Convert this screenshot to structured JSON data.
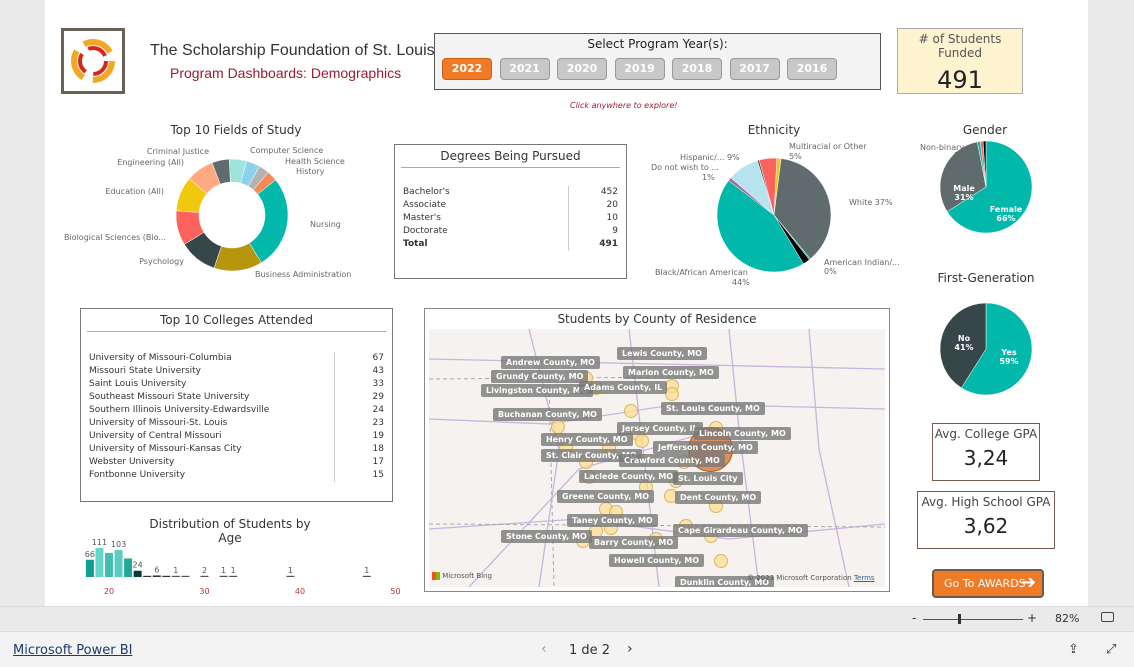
{
  "header": {
    "org": "The Scholarship Foundation of St. Louis",
    "subtitle": "Program Dashboards: Demographics",
    "logo_colors": [
      "#f5a623",
      "#d9261c"
    ]
  },
  "year_selector": {
    "label": "Select Program Year(s):",
    "years": [
      "2022",
      "2021",
      "2020",
      "2019",
      "2018",
      "2017",
      "2016"
    ],
    "selected": "2022",
    "hint": "Click anywhere to explore!"
  },
  "kpi_funded": {
    "label": "# of Students Funded",
    "value": "491"
  },
  "fields_of_study": {
    "title": "Top 10 Fields of Study",
    "slices": [
      {
        "name": "Computer Science",
        "value": 5,
        "color": "#9ee3dc"
      },
      {
        "name": "Health Science",
        "value": 4,
        "color": "#8ad3ea"
      },
      {
        "name": "History",
        "value": 3,
        "color": "#b3b3b3"
      },
      {
        "name": "",
        "value": 3,
        "color": "#f68a55"
      },
      {
        "name": "Nursing",
        "value": 27,
        "color": "#01b8aa"
      },
      {
        "name": "Business Administration",
        "value": 14,
        "color": "#b8960c"
      },
      {
        "name": "Psychology",
        "value": 11,
        "color": "#374649"
      },
      {
        "name": "Biological Sciences (Bio...",
        "value": 10,
        "color": "#fd625e"
      },
      {
        "name": "Education (All)",
        "value": 10,
        "color": "#f2c80f"
      },
      {
        "name": "Engineering (All)",
        "value": 8,
        "color": "#fea981"
      },
      {
        "name": "Criminal Justice",
        "value": 5,
        "color": "#5f6b6d"
      }
    ]
  },
  "degrees": {
    "title": "Degrees Being Pursued",
    "rows": [
      {
        "name": "Bachelor's",
        "count": "452"
      },
      {
        "name": "Associate",
        "count": "20"
      },
      {
        "name": "Master's",
        "count": "10"
      },
      {
        "name": "Doctorate",
        "count": "9"
      }
    ],
    "total": {
      "name": "Total",
      "count": "491"
    }
  },
  "ethnicity": {
    "title": "Ethnicity",
    "slices": [
      {
        "name": "",
        "value": 1.2,
        "color": "#f2c80f"
      },
      {
        "name": "White 37%",
        "value": 37,
        "color": "#5f6b6d"
      },
      {
        "name": "",
        "value": 0.4,
        "color": "#01b8aa"
      },
      {
        "name": "",
        "value": 2,
        "color": "#000000"
      },
      {
        "name": "Black/African American 44%",
        "value": 44,
        "color": "#01b8aa"
      },
      {
        "name": "Do not wish to ... 1%",
        "value": 1,
        "color": "#a66999"
      },
      {
        "name": "Hispanic/... 9%",
        "value": 9,
        "color": "#b7e3ee"
      },
      {
        "name": "",
        "value": 0.5,
        "color": "#374649"
      },
      {
        "name": "Multiracial or Other 5%",
        "value": 5,
        "color": "#fd625e"
      }
    ],
    "labels": {
      "white": "White 37%",
      "black": "Black/African American",
      "black_pct": "44%",
      "american_indian": "American Indian/...",
      "american_indian_pct": "0%",
      "hispanic": "Hispanic/... 9%",
      "dnw": "Do not wish to ...",
      "dnw_pct": "1%",
      "multi": "Multiracial or Other",
      "multi_pct": "5%"
    }
  },
  "gender": {
    "title": "Gender",
    "slices": [
      {
        "name": "Female",
        "pct": "66%",
        "value": 66,
        "color": "#01b8aa"
      },
      {
        "name": "Male",
        "pct": "31%",
        "value": 31,
        "color": "#5f6b6d"
      },
      {
        "name": "Non-binary",
        "pct": "1%",
        "value": 1,
        "color": "#01b8aa"
      },
      {
        "name": "",
        "value": 1,
        "color": "#fd625e"
      },
      {
        "name": "",
        "value": 1,
        "color": "#000000"
      }
    ]
  },
  "first_gen": {
    "title": "First-Generation",
    "slices": [
      {
        "name": "Yes",
        "pct": "59%",
        "value": 59,
        "color": "#01b8aa"
      },
      {
        "name": "No",
        "pct": "41%",
        "value": 41,
        "color": "#374649"
      }
    ]
  },
  "colleges": {
    "title": "Top 10 Colleges Attended",
    "rows": [
      {
        "name": "University of Missouri-Columbia",
        "count": "67"
      },
      {
        "name": "Missouri State University",
        "count": "43"
      },
      {
        "name": "Saint Louis University",
        "count": "33"
      },
      {
        "name": "Southeast Missouri State University",
        "count": "29"
      },
      {
        "name": "Southern Illinois University-Edwardsville",
        "count": "24"
      },
      {
        "name": "University of Missouri-St. Louis",
        "count": "23"
      },
      {
        "name": "University of Central Missouri",
        "count": "19"
      },
      {
        "name": "University of Missouri-Kansas City",
        "count": "18"
      },
      {
        "name": "Webster University",
        "count": "17"
      },
      {
        "name": "Fontbonne University",
        "count": "15"
      }
    ]
  },
  "chart_data": {
    "type": "bar",
    "title": "Distribution of Students by Age",
    "x_ticks": [
      "20",
      "30",
      "40",
      "50"
    ],
    "xlim": [
      17,
      50
    ],
    "x": [
      18,
      19,
      20,
      21,
      22,
      23,
      24,
      25,
      26,
      27,
      28,
      30,
      32,
      33,
      39,
      47
    ],
    "values": [
      66,
      111,
      92,
      103,
      71,
      24,
      2,
      6,
      2,
      1,
      1,
      2,
      1,
      1,
      1,
      1
    ],
    "labels": [
      "66",
      "111",
      "",
      "103",
      "",
      "24",
      "",
      "6",
      "",
      "1",
      "",
      "2",
      "1",
      "1",
      "1",
      "1"
    ],
    "colors": [
      "#119f8f",
      "#64d6cc",
      "#45bcb0",
      "#5ccbc0",
      "#22a798",
      "#0b3b36",
      "#333",
      "#333",
      "#333",
      "#555",
      "#555",
      "#555",
      "#555",
      "#555",
      "#555",
      "#555"
    ]
  },
  "map": {
    "title": "Students by County of Residence",
    "attribution": "© 2023 Microsoft Corporation",
    "terms": "Terms",
    "brand": "Microsoft Bing",
    "counties": [
      "Andrew County, MO",
      "Grundy County, MO",
      "Livingston County, MO",
      "Adams County, IL",
      "Lewis County, MO",
      "Marion County, MO",
      "Buchanan County, MO",
      "St. Louis County, MO",
      "Jersey County, IL",
      "Lincoln County, MO",
      "Henry County, MO",
      "Jefferson County, MO",
      "St. Clair County, MO",
      "Crawford County, MO",
      "Laclede County, MO",
      "St. Louis City",
      "Greene County, MO",
      "Dent County, MO",
      "Taney County, MO",
      "Cape Girardeau County, MO",
      "Stone County, MO",
      "Barry County, MO",
      "Howell County, MO",
      "Dunklin County, MO"
    ]
  },
  "gpa": {
    "college": {
      "label": "Avg. College GPA",
      "value": "3,24"
    },
    "high_school": {
      "label": "Avg. High School GPA",
      "value": "3,62"
    }
  },
  "awards_button": {
    "label": "Go To AWARDS",
    "icon": "arrow-right-icon"
  },
  "toolbar": {
    "minus": "-",
    "plus": "+",
    "zoom": "82%",
    "zoom_level": 82
  },
  "footer": {
    "brand": "Microsoft Power BI",
    "page": "1 de 2"
  }
}
